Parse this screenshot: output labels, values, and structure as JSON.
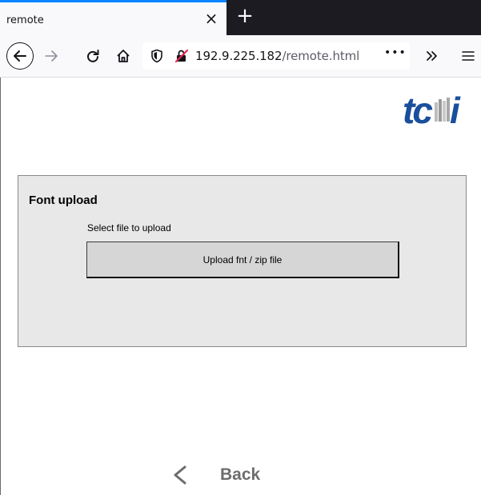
{
  "browser": {
    "tab_title": "remote",
    "tab_close": "×",
    "new_tab": "+",
    "url_host": "192.9.225.182",
    "url_path": "/remote.html",
    "page_actions": "•••"
  },
  "page": {
    "logo_text": "tci",
    "panel_title": "Font upload",
    "select_label": "Select file to upload",
    "upload_button": "Upload fnt / zip file",
    "back_label": "Back"
  },
  "colors": {
    "tab_accent": "#0a84ff",
    "logo_blue": "#1a4f9c",
    "panel_bg": "#e8e8e8",
    "button_bg": "#d6d6d6",
    "back_gray": "#6d6d6d"
  },
  "icons": [
    "back-arrow-icon",
    "forward-arrow-icon",
    "reload-icon",
    "home-icon",
    "shield-icon",
    "insecure-lock-icon",
    "overflow-chevron-icon",
    "hamburger-menu-icon",
    "back-chevron-icon"
  ]
}
